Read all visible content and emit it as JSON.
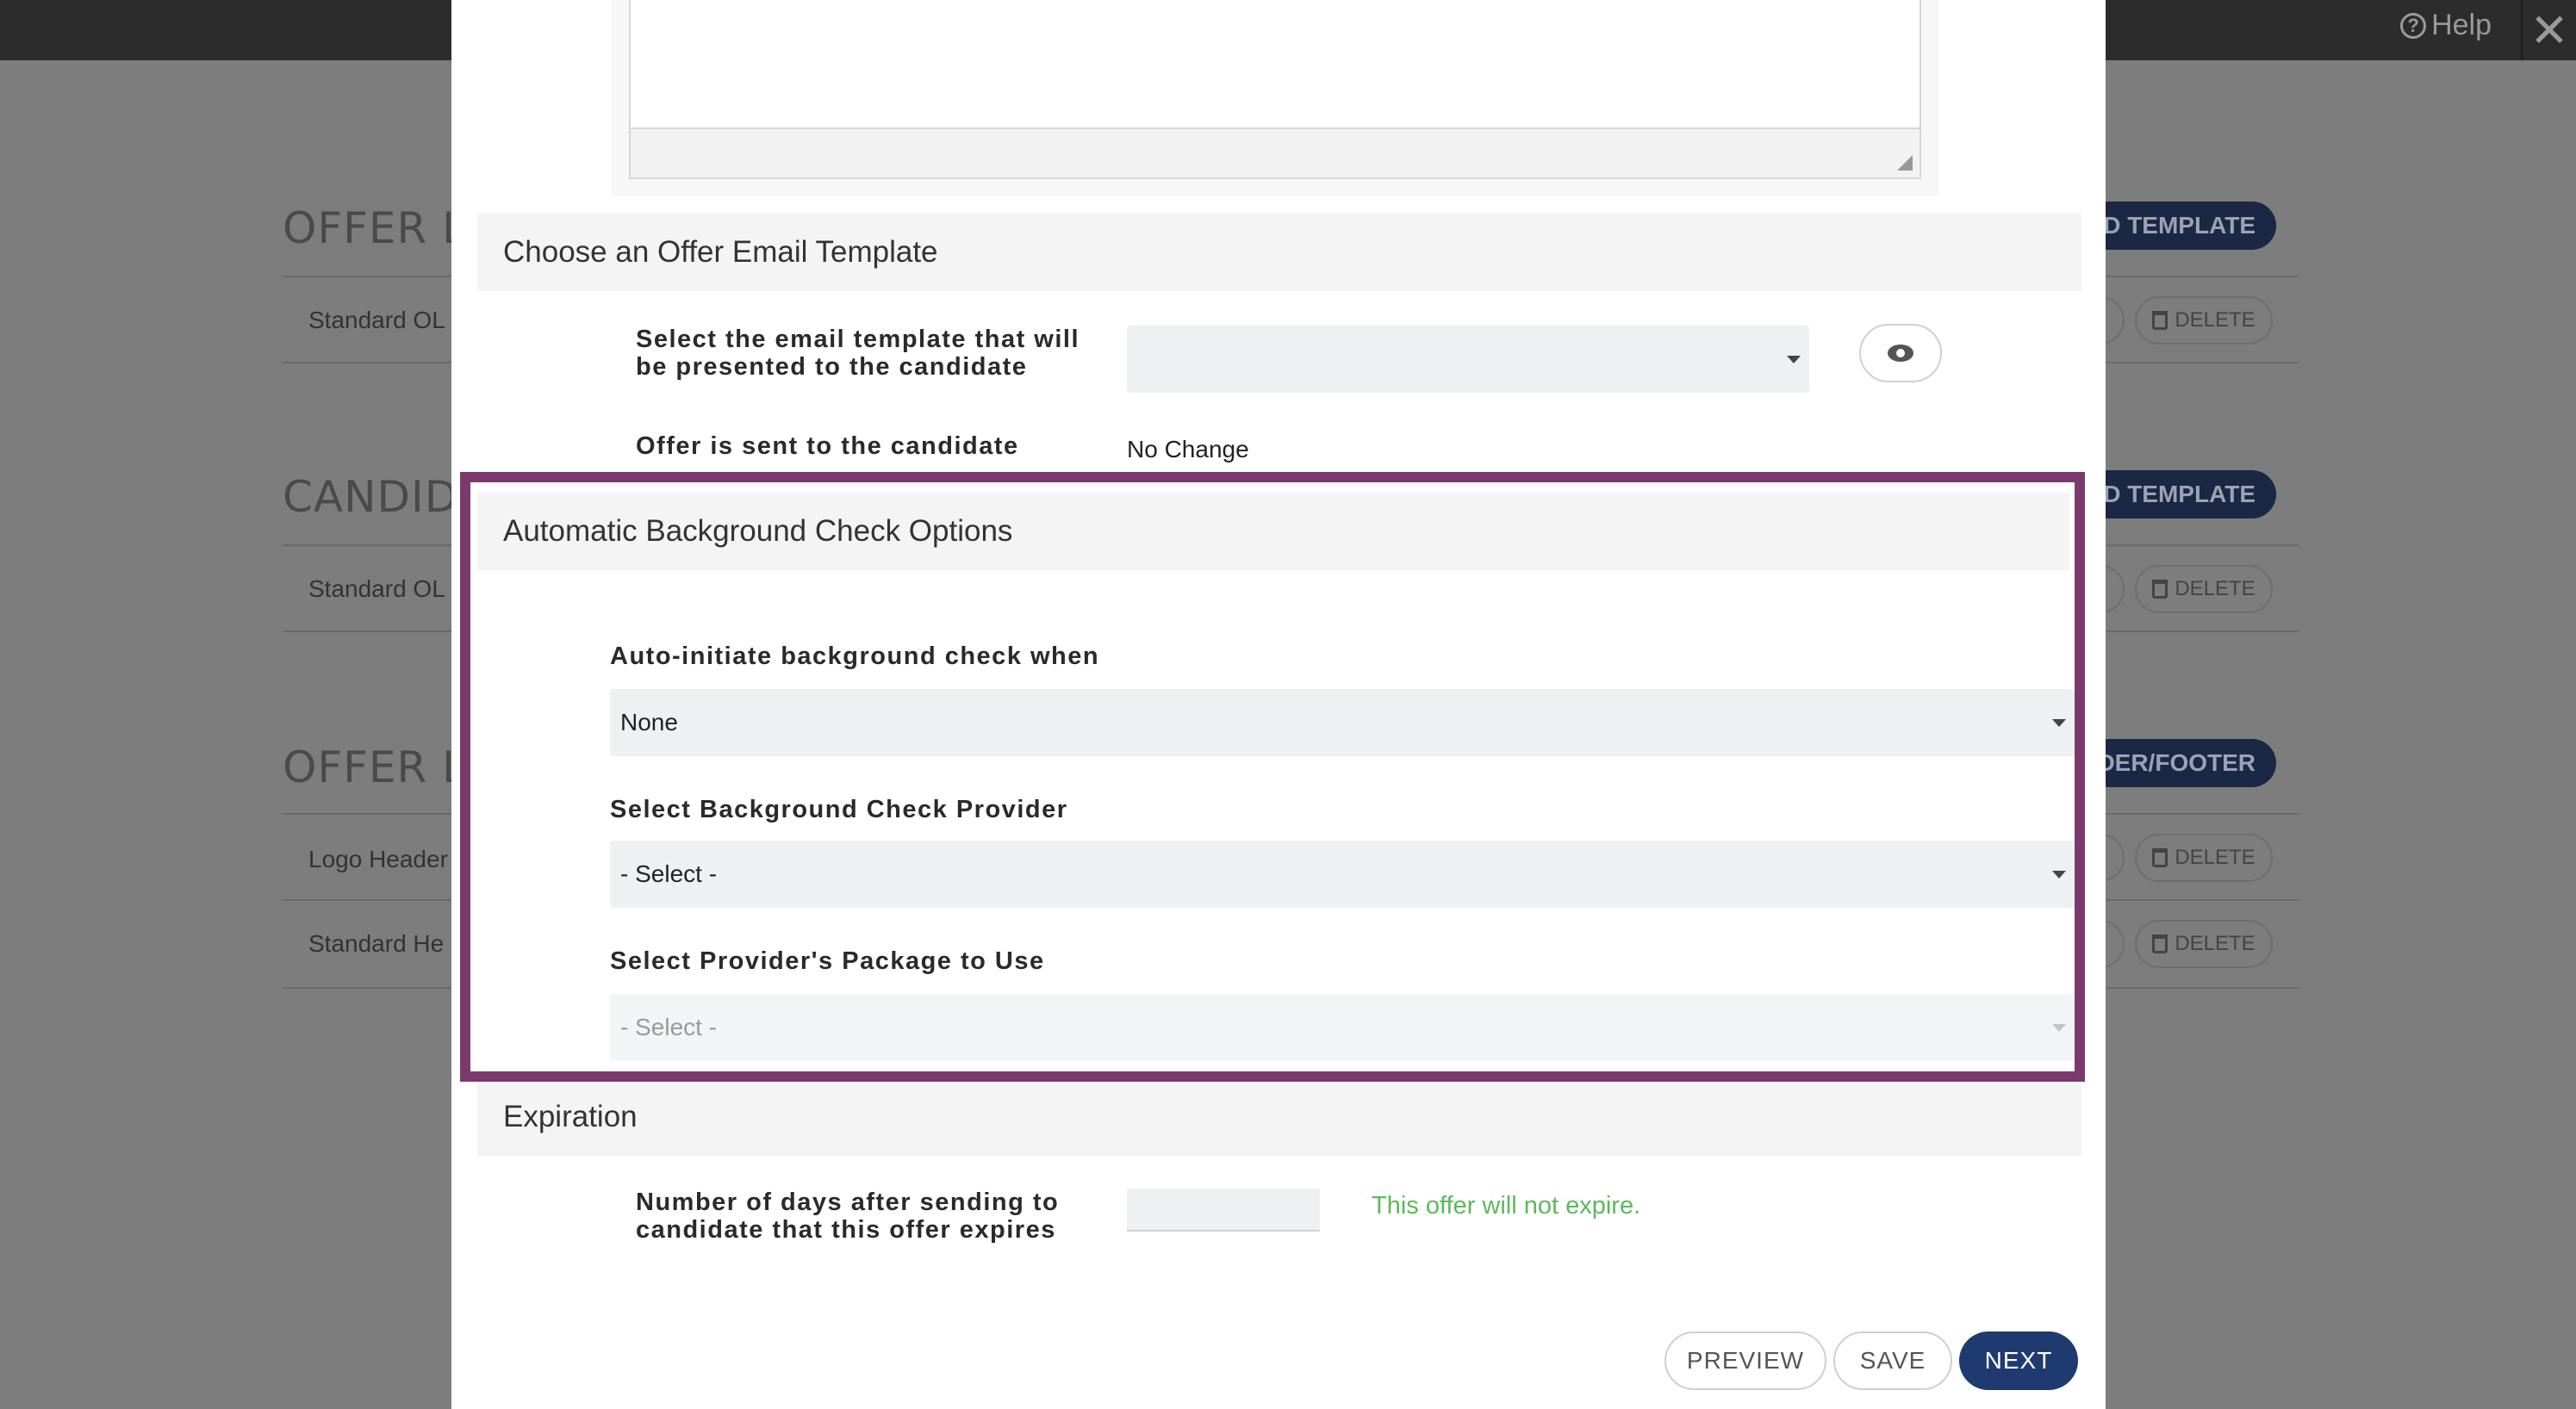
{
  "background": {
    "help_label": "Help",
    "close_glyph": "✕",
    "sections": [
      {
        "title": "OFFER LE",
        "button": "D TEMPLATE",
        "rows": [
          "Standard OL"
        ]
      },
      {
        "title": "CANDIDA",
        "button": "D TEMPLATE",
        "rows": [
          "Standard OL"
        ]
      },
      {
        "title": "OFFER LE",
        "button": "ADER/FOOTER",
        "rows": [
          "Logo Header",
          "Standard He"
        ]
      }
    ],
    "delete_label": "DELETE"
  },
  "modal": {
    "email_template": {
      "header": "Choose an Offer Email Template",
      "select_label": "Select the email template that will be presented to the candidate",
      "select_value": "",
      "preview_icon": "eye-icon",
      "sent_label": "Offer is sent to the candidate",
      "sent_value": "No Change"
    },
    "background_check": {
      "header": "Automatic Background Check Options",
      "auto_label": "Auto-initiate background check when",
      "auto_value": "None",
      "provider_label": "Select Background Check Provider",
      "provider_value": "- Select -",
      "package_label": "Select Provider's Package to Use",
      "package_value": "- Select -"
    },
    "expiration": {
      "header": "Expiration",
      "days_label": "Number of days after sending to candidate that this offer expires",
      "days_value": "",
      "hint": "This offer will not expire."
    },
    "buttons": {
      "preview": "PREVIEW",
      "save": "SAVE",
      "next": "NEXT"
    }
  },
  "colors": {
    "highlight": "#7b3a6b",
    "primary": "#1f3a6e",
    "success_text": "#5cb85c"
  }
}
